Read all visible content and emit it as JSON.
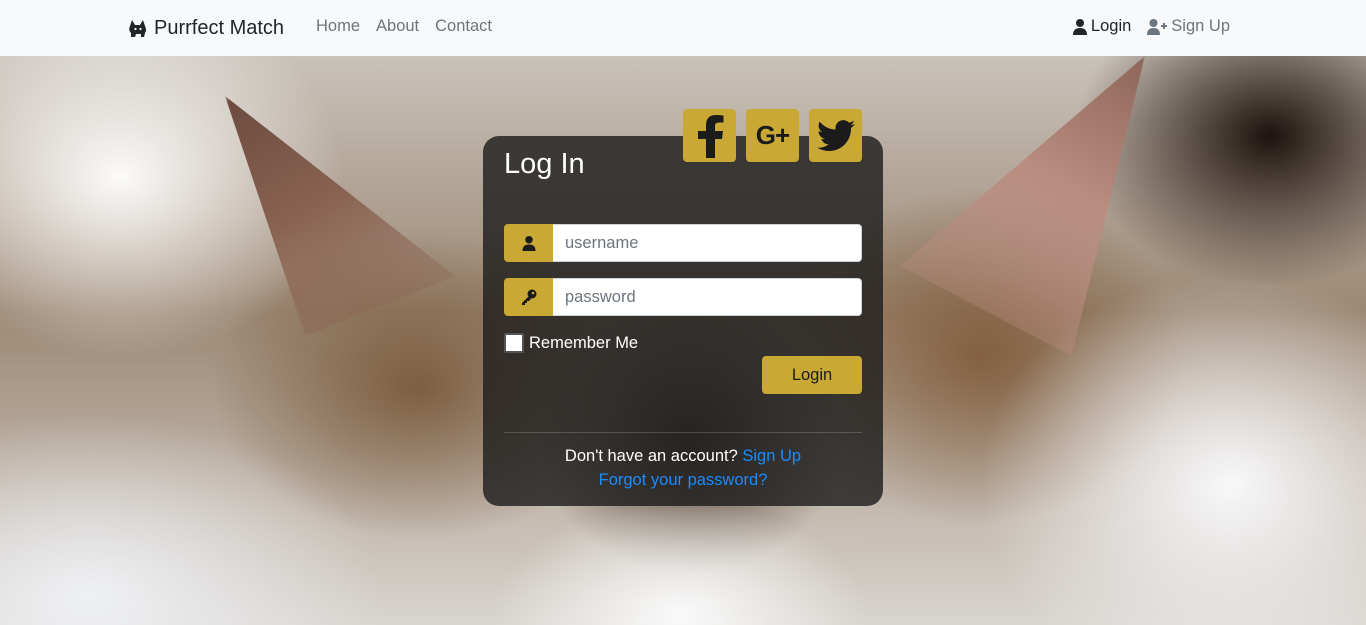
{
  "navbar": {
    "brand": "Purrfect Match",
    "links": [
      "Home",
      "About",
      "Contact"
    ],
    "login_label": "Login",
    "signup_label": "Sign Up"
  },
  "login_card": {
    "title": "Log In",
    "social": [
      {
        "name": "facebook-icon"
      },
      {
        "name": "google-plus-icon",
        "label": "G+"
      },
      {
        "name": "twitter-icon"
      }
    ],
    "username_placeholder": "username",
    "password_placeholder": "password",
    "remember_label": "Remember Me",
    "remember_checked": false,
    "submit_label": "Login",
    "no_account_text": "Don't have an account?",
    "signup_link": "Sign Up",
    "forgot_link": "Forgot your password?"
  },
  "colors": {
    "accent": "#c9a835",
    "navbar_bg": "#f8f9fa",
    "link": "#1a8cff",
    "card_bg": "rgba(28,28,28,0.80)"
  }
}
